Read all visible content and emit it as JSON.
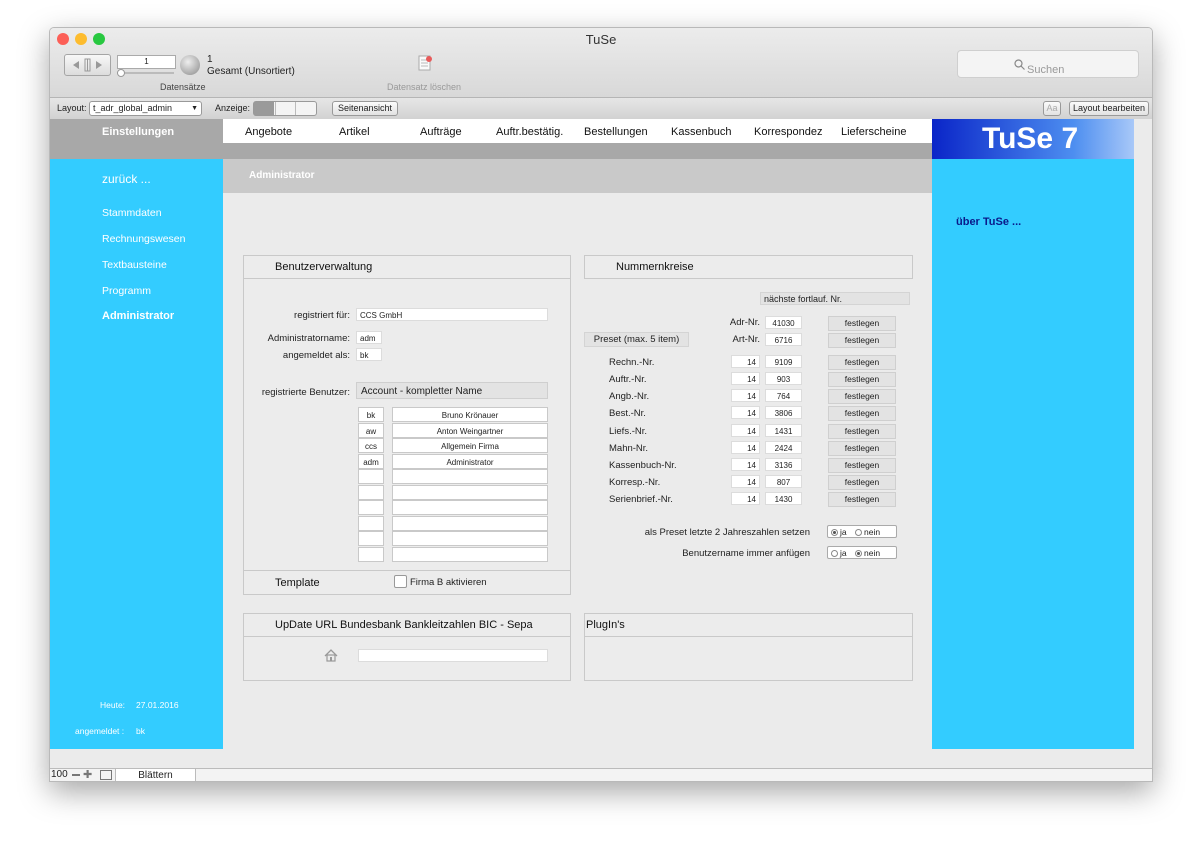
{
  "window": {
    "title": "TuSe",
    "traffic_colors": {
      "close": "#fc5f57",
      "minimize": "#fdbc2e",
      "zoom": "#28c840"
    }
  },
  "toolbar": {
    "record_number": "1",
    "total_count": "1",
    "total_label": "Gesamt (Unsortiert)",
    "records_label": "Datensätze",
    "delete_label": "Datensatz löschen",
    "search_placeholder": "Suchen"
  },
  "layoutbar": {
    "layout_label": "Layout:",
    "layout_value": "t_adr_global_admin",
    "view_label": "Anzeige:",
    "preview_button": "Seitenansicht",
    "font_button": "Aa",
    "edit_layout_button": "Layout bearbeiten"
  },
  "nav": {
    "settings": "Einstellungen",
    "tabs": [
      "Angebote",
      "Artikel",
      "Aufträge",
      "Auftr.bestätig.",
      "Bestellungen",
      "Kassenbuch",
      "Korrespondez",
      "Lieferscheine"
    ],
    "logo": "TuSe 7",
    "logo_bg": "#0a25c8"
  },
  "sidebar": {
    "back": "zurück ...",
    "items": [
      "Stammdaten",
      "Rechnungswesen",
      "Textbausteine",
      "Programm",
      "Administrator"
    ],
    "today_label": "Heute:",
    "today_value": "27.01.2016",
    "logged_label": "angemeldet :",
    "logged_value": "bk",
    "bg_color": "#33ccff"
  },
  "main": {
    "section_title": "Administrator"
  },
  "user_admin": {
    "title": "Benutzerverwaltung",
    "registered_for_label": "registriert für:",
    "registered_for_value": "CCS GmbH",
    "admin_name_label": "Administratorname:",
    "admin_name_value": "adm",
    "logged_in_label": "angemeldet als:",
    "logged_in_value": "bk",
    "users_label": "registrierte Benutzer:",
    "users_header": "Account - kompletter Name",
    "users": [
      {
        "account": "bk",
        "name": "Bruno Krönauer"
      },
      {
        "account": "aw",
        "name": "Anton Weingartner"
      },
      {
        "account": "ccs",
        "name": "Allgemein Firma"
      },
      {
        "account": "adm",
        "name": "Administrator"
      }
    ],
    "template_label": "Template",
    "template_checkbox_label": "Firma B  aktivieren"
  },
  "numbers": {
    "title": "Nummernkreise",
    "next_label": "nächste fortlauf. Nr.",
    "preset_label": "Preset (max. 5 item)",
    "fix_button": "festlegen",
    "adr_label": "Adr-Nr.",
    "adr_value": "41030",
    "art_label": "Art-Nr.",
    "art_value": "6716",
    "rows": [
      {
        "label": "Rechn.-Nr.",
        "preset": "14",
        "value": "9109"
      },
      {
        "label": "Auftr.-Nr.",
        "preset": "14",
        "value": "903"
      },
      {
        "label": "Angb.-Nr.",
        "preset": "14",
        "value": "764"
      },
      {
        "label": "Best.-Nr.",
        "preset": "14",
        "value": "3806"
      },
      {
        "label": "Liefs.-Nr.",
        "preset": "14",
        "value": "1431"
      },
      {
        "label": "Mahn-Nr.",
        "preset": "14",
        "value": "2424"
      },
      {
        "label": "Kassenbuch-Nr.",
        "preset": "14",
        "value": "3136"
      },
      {
        "label": "Korresp.-Nr.",
        "preset": "14",
        "value": "807"
      },
      {
        "label": "Serienbrief.-Nr.",
        "preset": "14",
        "value": "1430"
      }
    ],
    "preset_year_label": "als Preset letzte 2 Jahreszahlen setzen",
    "append_user_label": "Benutzername immer anfügen",
    "yes": "ja",
    "no": "nein"
  },
  "update": {
    "title": "UpDate URL Bundesbank Bankleitzahlen BIC - Sepa"
  },
  "plugins": {
    "title": "PlugIn's"
  },
  "about": {
    "label": "über TuSe ..."
  },
  "status": {
    "zoom": "100",
    "mode": "Blättern"
  }
}
